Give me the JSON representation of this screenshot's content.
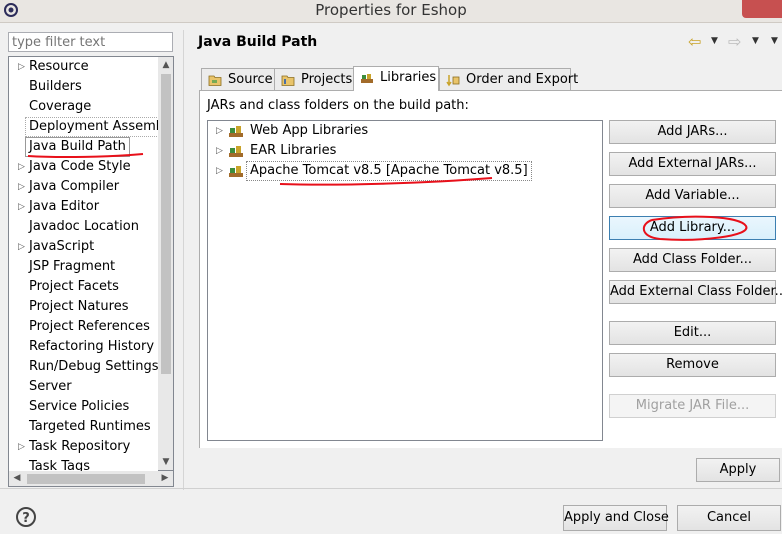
{
  "window": {
    "title": "Properties for Eshop"
  },
  "filter": {
    "placeholder": "type filter text"
  },
  "sidebar": {
    "items": [
      {
        "label": "Resource",
        "expandable": true
      },
      {
        "label": "Builders",
        "expandable": false
      },
      {
        "label": "Coverage",
        "expandable": false
      },
      {
        "label": "Deployment Assembly",
        "expandable": false
      },
      {
        "label": "Java Build Path",
        "expandable": false
      },
      {
        "label": "Java Code Style",
        "expandable": true
      },
      {
        "label": "Java Compiler",
        "expandable": true
      },
      {
        "label": "Java Editor",
        "expandable": true
      },
      {
        "label": "Javadoc Location",
        "expandable": false
      },
      {
        "label": "JavaScript",
        "expandable": true
      },
      {
        "label": "JSP Fragment",
        "expandable": false
      },
      {
        "label": "Project Facets",
        "expandable": false
      },
      {
        "label": "Project Natures",
        "expandable": false
      },
      {
        "label": "Project References",
        "expandable": false
      },
      {
        "label": "Refactoring History",
        "expandable": false
      },
      {
        "label": "Run/Debug Settings",
        "expandable": false
      },
      {
        "label": "Server",
        "expandable": false
      },
      {
        "label": "Service Policies",
        "expandable": false
      },
      {
        "label": "Targeted Runtimes",
        "expandable": false
      },
      {
        "label": "Task Repository",
        "expandable": true
      },
      {
        "label": "Task Tags",
        "expandable": false
      }
    ]
  },
  "page": {
    "title": "Java Build Path"
  },
  "tabs": [
    {
      "label": "Source",
      "icon": "source-folder-icon"
    },
    {
      "label": "Projects",
      "icon": "projects-icon"
    },
    {
      "label": "Libraries",
      "icon": "libraries-icon",
      "active": true
    },
    {
      "label": "Order and Export",
      "icon": "order-export-icon"
    }
  ],
  "libraries": {
    "label": "JARs and class folders on the build path:",
    "items": [
      {
        "label": "Web App Libraries"
      },
      {
        "label": "EAR Libraries"
      },
      {
        "label": "Apache Tomcat v8.5 [Apache Tomcat v8.5]",
        "selected": true
      }
    ]
  },
  "buttons": {
    "add_jars": "Add JARs...",
    "add_external_jars": "Add External JARs...",
    "add_variable": "Add Variable...",
    "add_library": "Add Library...",
    "add_class_folder": "Add Class Folder...",
    "add_external_class_folder": "Add External Class Folder...",
    "edit": "Edit...",
    "remove": "Remove",
    "migrate_jar": "Migrate JAR File...",
    "apply": "Apply",
    "apply_and_close": "Apply and Close",
    "cancel": "Cancel"
  },
  "colors": {
    "annotation": "#e8101a",
    "close_button": "#c75050"
  }
}
